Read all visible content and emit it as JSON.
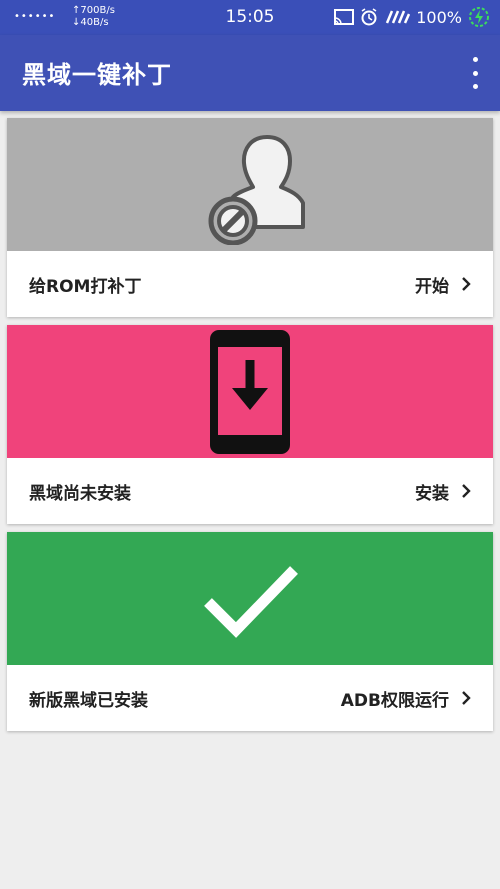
{
  "statusbar": {
    "signal": "••••••",
    "speed_up": "↑700B/s",
    "speed_down": "↓40B/s",
    "time": "15:05",
    "battery": "100%"
  },
  "appbar": {
    "title": "黑域一键补丁"
  },
  "cards": [
    {
      "label": "给ROM打补丁",
      "action": "开始",
      "color": "#aeaeae",
      "icon": "blocked-user-icon"
    },
    {
      "label": "黑域尚未安装",
      "action": "安装",
      "color": "#f0437b",
      "icon": "phone-download-icon"
    },
    {
      "label": "新版黑域已安装",
      "action": "ADB权限运行",
      "color": "#33a854",
      "icon": "checkmark-icon"
    }
  ]
}
